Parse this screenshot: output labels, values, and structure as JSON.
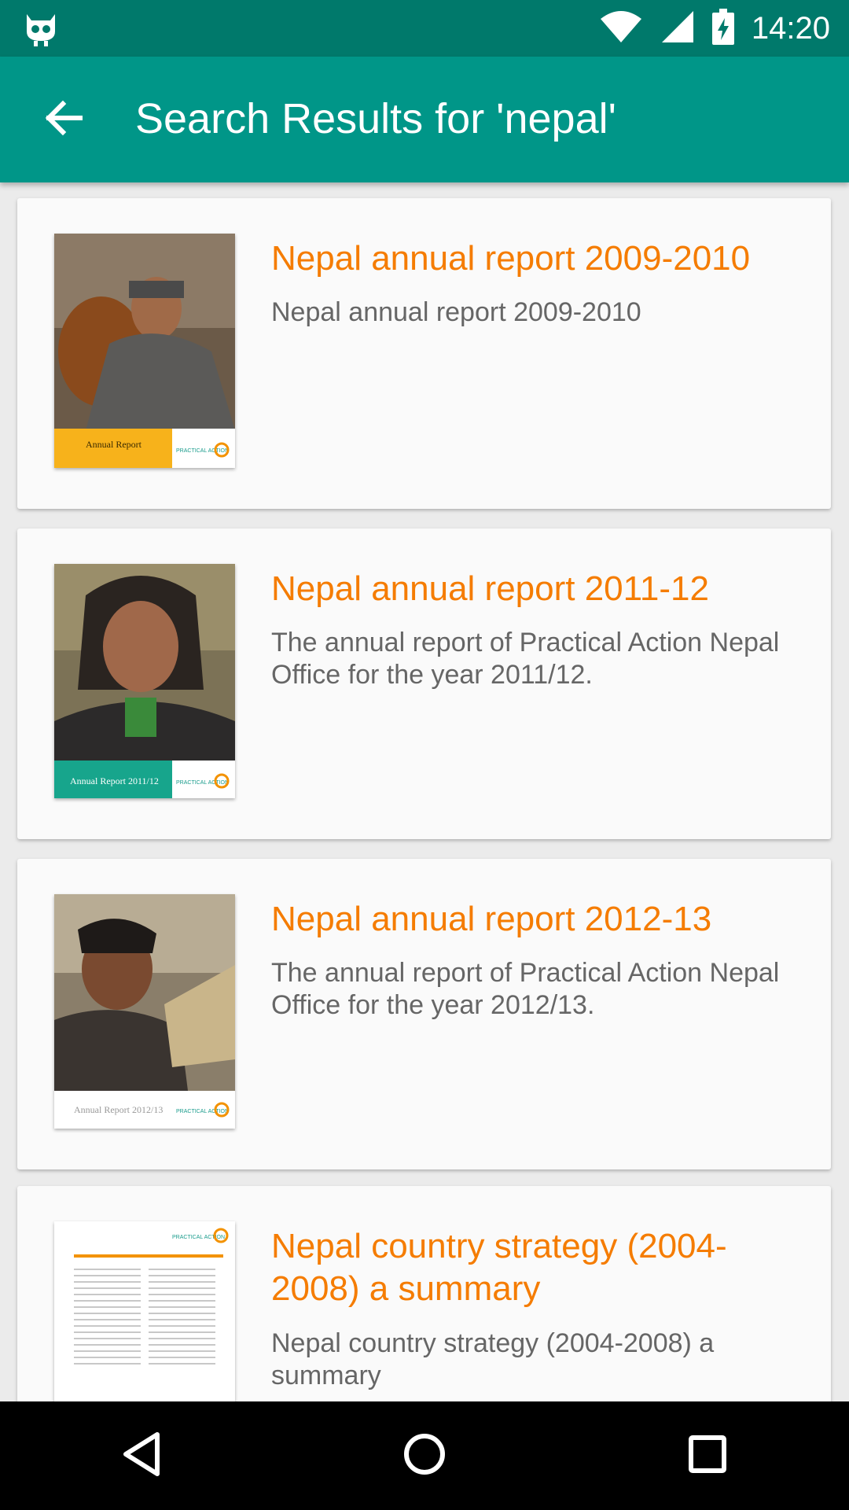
{
  "status_bar": {
    "time": "14:20",
    "icons": [
      "android-debug-icon",
      "wifi-icon",
      "signal-icon",
      "battery-charging-icon"
    ]
  },
  "app_bar": {
    "back_icon": "arrow-back-icon",
    "title": "Search Results for 'nepal'"
  },
  "results": [
    {
      "title": "Nepal annual report 2009-2010",
      "description": "Nepal annual report 2009-2010",
      "thumb_caption": "Annual Report",
      "thumb_brand": "PRACTICAL ACTION",
      "thumb_band_color": "#f7b21b"
    },
    {
      "title": "Nepal annual report 2011-12",
      "description": "The annual report of Practical Action Nepal Office for the year 2011/12.",
      "thumb_caption": "Annual Report 2011/12",
      "thumb_brand": "PRACTICAL ACTION",
      "thumb_band_color": "#17a58c"
    },
    {
      "title": "Nepal annual report 2012-13",
      "description": "The annual report of Practical Action Nepal Office for the year 2012/13.",
      "thumb_caption": "Annual Report 2012/13",
      "thumb_brand": "PRACTICAL ACTION",
      "thumb_band_color": "#ffffff"
    },
    {
      "title": "Nepal country strategy (2004-2008) a summary",
      "description": "Nepal country strategy (2004-2008) a summary",
      "thumb_brand": "PRACTICAL ACTION"
    }
  ],
  "nav_bar": {
    "back_icon": "nav-back-triangle-icon",
    "home_icon": "nav-home-circle-icon",
    "recents_icon": "nav-recents-square-icon"
  },
  "colors": {
    "status_bar": "#00796b",
    "app_bar": "#009688",
    "title_orange": "#f57c00",
    "description_gray": "#666666"
  }
}
